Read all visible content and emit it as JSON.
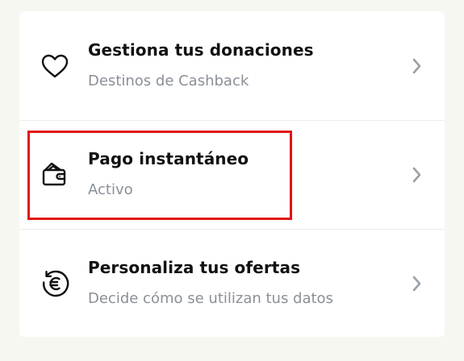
{
  "items": [
    {
      "title": "Gestiona tus donaciones",
      "subtitle": "Destinos de Cashback",
      "icon": "heart-icon"
    },
    {
      "title": "Pago instantáneo",
      "subtitle": "Activo",
      "icon": "wallet-icon"
    },
    {
      "title": "Personaliza tus ofertas",
      "subtitle": "Decide cómo se utilizan tus datos",
      "icon": "euro-refresh-icon"
    }
  ],
  "colors": {
    "background": "#f7f7f2",
    "card": "#ffffff",
    "title": "#111111",
    "subtitle": "#8a8f98",
    "highlight": "#e11313",
    "chevron": "#9aa0a6"
  }
}
